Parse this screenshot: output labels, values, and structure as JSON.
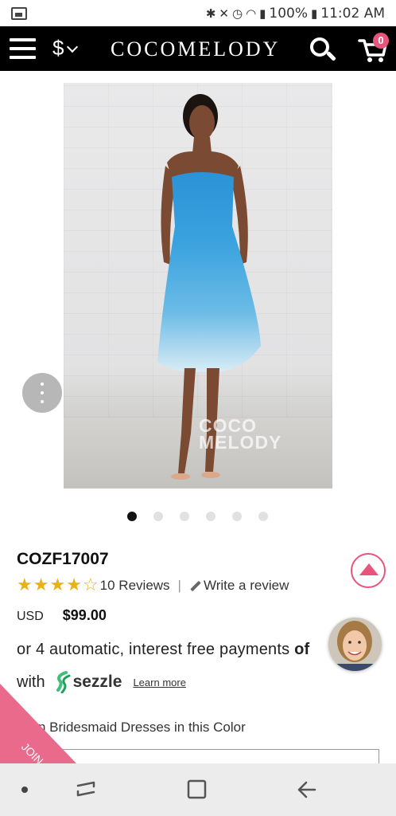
{
  "status_bar": {
    "battery": "100%",
    "time": "11:02 AM"
  },
  "header": {
    "currency_symbol": "$",
    "brand": "COCOMELODY",
    "cart_count": "0"
  },
  "product": {
    "image_watermark_line1": "COCO",
    "image_watermark_line2": "MELODY",
    "gallery": {
      "total_images": 6,
      "active_index": 0
    },
    "sku": "COZF17007",
    "rating": {
      "stars_filled": 4,
      "stars_total": 5,
      "reviews_label": "10 Reviews",
      "separator": "|",
      "write_label": "Write a review"
    },
    "currency_code": "USD",
    "price": "$99.00",
    "installments": {
      "text": "or 4 automatic, interest free payments ",
      "bold": "of"
    },
    "sezzle": {
      "prefix": "with",
      "brand": "sezzle",
      "learn_more": "Learn more"
    },
    "color_section_label": "n Bridesmaid Dresses in this Color"
  },
  "join_label": "JOIN",
  "colors": {
    "accent_pink": "#e8557c",
    "star_gold": "#e8b114",
    "header_bg": "#000000"
  }
}
